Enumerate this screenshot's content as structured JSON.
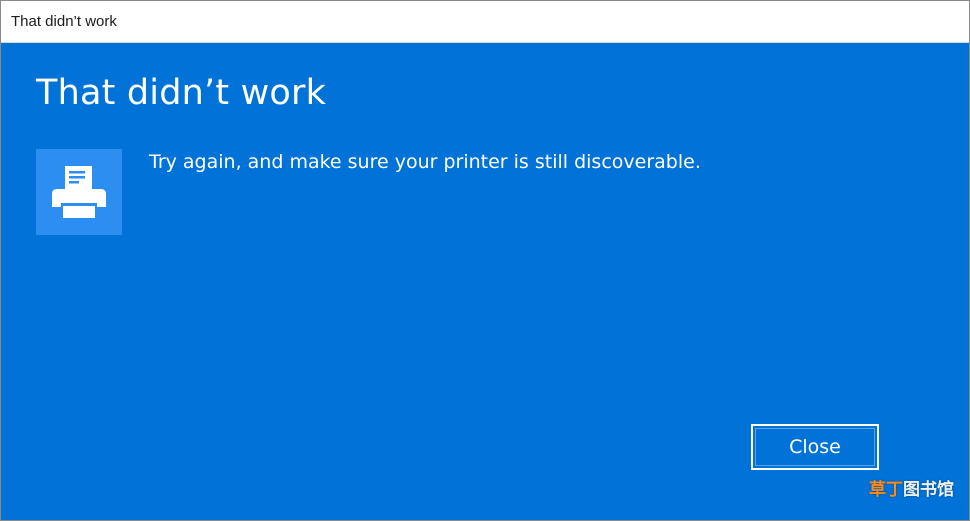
{
  "window": {
    "title": "That didn’t work"
  },
  "dialog": {
    "heading": "That didn’t work",
    "icon": "printer-icon",
    "message": "Try again, and make sure your printer is still discoverable.",
    "close_label": "Close"
  },
  "watermark": {
    "accent": "草丁",
    "rest": "图书馆"
  },
  "colors": {
    "accent_blue": "#0072d8",
    "icon_tile": "#2b8ef0",
    "text": "#ffffff"
  }
}
